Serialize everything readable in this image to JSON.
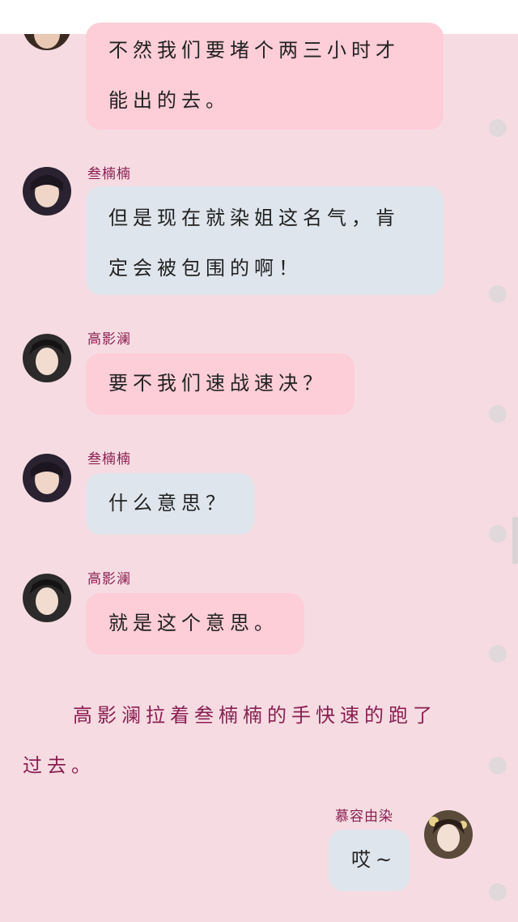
{
  "messages": [
    {
      "sender": "",
      "side": "left",
      "color": "pink",
      "lines": [
        "不然我们要堵个两三小时才",
        "能出的去。"
      ]
    },
    {
      "sender": "叁楠楠",
      "side": "left",
      "color": "blue",
      "lines": [
        "但是现在就染姐这名气，肯",
        "定会被包围的啊！"
      ]
    },
    {
      "sender": "高影澜",
      "side": "left",
      "color": "pink",
      "lines": [
        "要不我们速战速决？"
      ]
    },
    {
      "sender": "叁楠楠",
      "side": "left",
      "color": "blue",
      "lines": [
        "什么意思？"
      ]
    },
    {
      "sender": "高影澜",
      "side": "left",
      "color": "pink",
      "lines": [
        "就是这个意思。"
      ]
    },
    {
      "sender": "慕容由染",
      "side": "right",
      "color": "blue",
      "lines": [
        "哎~"
      ]
    }
  ],
  "narration": {
    "line1": "高影澜拉着叁楠楠的手快速的跑了",
    "line2": "过去。"
  },
  "colors": {
    "background": "#f6dce2",
    "pink_bubble": "#fdcdd8",
    "blue_bubble": "#dfe5ec",
    "name_text": "#8a1f52"
  }
}
